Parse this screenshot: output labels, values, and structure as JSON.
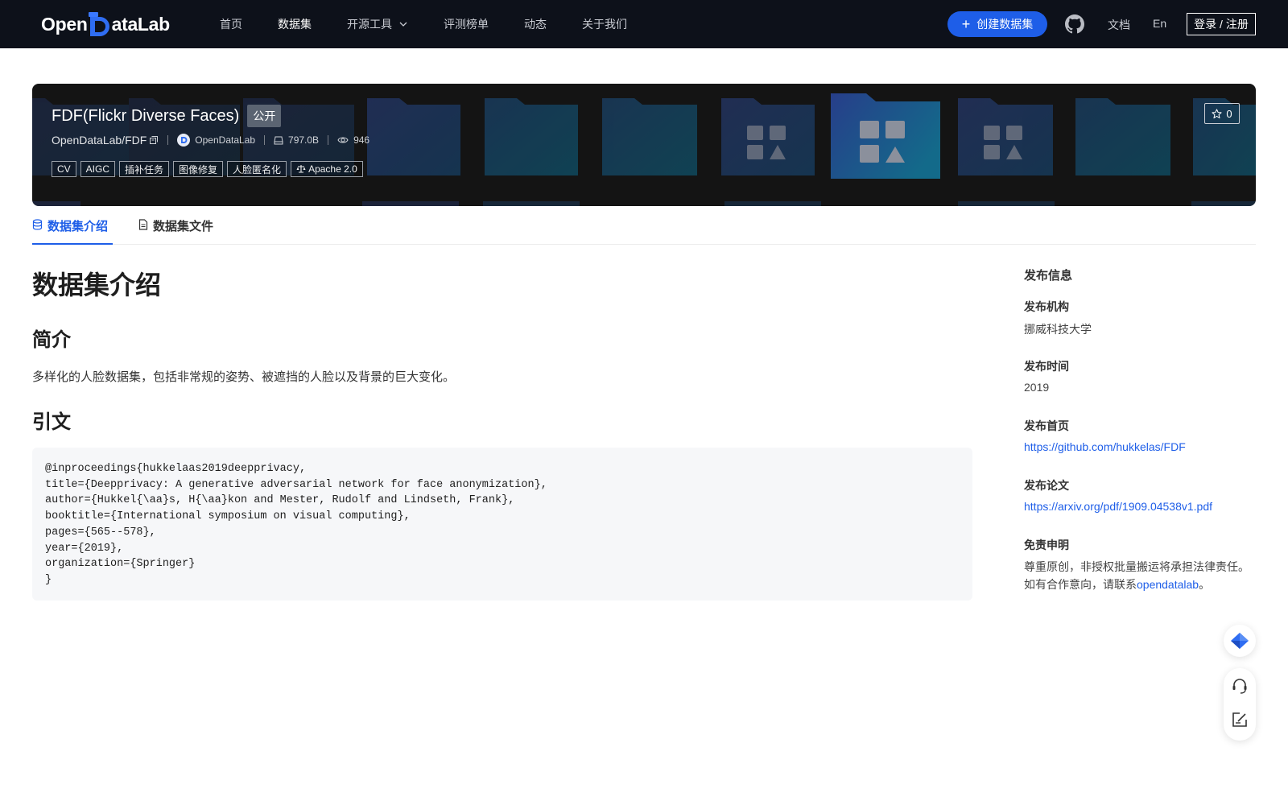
{
  "nav": {
    "logo_left": "Open",
    "logo_right": "ataLab",
    "items": [
      {
        "label": "首页"
      },
      {
        "label": "数据集"
      },
      {
        "label": "开源工具"
      },
      {
        "label": "评测榜单"
      },
      {
        "label": "动态"
      },
      {
        "label": "关于我们"
      }
    ],
    "create_label": "创建数据集",
    "docs_label": "文档",
    "lang_label": "En",
    "login_label": "登录 / 注册"
  },
  "banner": {
    "title": "FDF(Flickr Diverse Faces)",
    "visibility": "公开",
    "repo": "OpenDataLab/FDF",
    "org": "OpenDataLab",
    "size": "797.0B",
    "views": "946",
    "tags": [
      "CV",
      "AIGC",
      "插补任务",
      "图像修复",
      "人脸匿名化"
    ],
    "license": "Apache 2.0",
    "stars": "0"
  },
  "tabs": {
    "intro": "数据集介绍",
    "files": "数据集文件"
  },
  "content": {
    "heading": "数据集介绍",
    "summary_heading": "简介",
    "summary": "多样化的人脸数据集，包括非常规的姿势、被遮挡的人脸以及背景的巨大变化。",
    "citation_heading": "引文",
    "citation": "@inproceedings{hukkelaas2019deepprivacy,\ntitle={Deepprivacy: A generative adversarial network for face anonymization},\nauthor={Hukkel{\\aa}s, H{\\aa}kon and Mester, Rudolf and Lindseth, Frank},\nbooktitle={International symposium on visual computing},\npages={565--578},\nyear={2019},\norganization={Springer}\n}"
  },
  "sidebar": {
    "title": "发布信息",
    "org_label": "发布机构",
    "org_value": "挪威科技大学",
    "time_label": "发布时间",
    "time_value": "2019",
    "home_label": "发布首页",
    "home_value": "https://github.com/hukkelas/FDF",
    "paper_label": "发布论文",
    "paper_value": "https://arxiv.org/pdf/1909.04538v1.pdf",
    "disclaimer_label": "免责申明",
    "disclaimer_line1": "尊重原创，非授权批量搬运将承担法律责任。",
    "disclaimer_line2_prefix": "如有合作意向，请联系",
    "disclaimer_link": "opendatalab",
    "disclaimer_line2_suffix": "。"
  },
  "colors": {
    "nav_bg": "#0d111a",
    "accent": "#1e5ee8",
    "banner_bg": "#141414",
    "code_bg": "#f6f7f9"
  }
}
